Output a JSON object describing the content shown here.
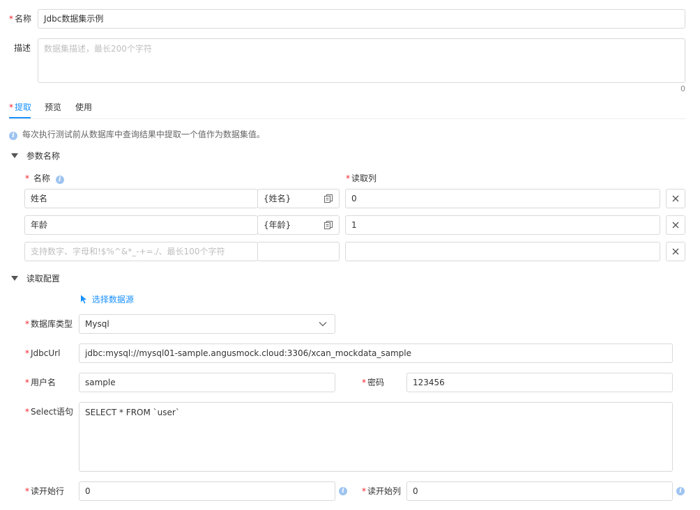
{
  "form": {
    "name_label": "名称",
    "name_value": "Jdbc数据集示例",
    "desc_label": "描述",
    "desc_placeholder": "数据集描述，最长200个字符",
    "desc_count": "0"
  },
  "tabs": [
    {
      "label": "提取",
      "active": true,
      "required": true
    },
    {
      "label": "预览",
      "active": false
    },
    {
      "label": "使用",
      "active": false
    }
  ],
  "hint": "每次执行测试前从数据库中查询结果中提取一个值作为数据集值。",
  "params_section": {
    "title": "参数名称",
    "col_name": "名称",
    "col_read": "读取列",
    "rows": [
      {
        "name": "姓名",
        "var": "{姓名}",
        "col": "0"
      },
      {
        "name": "年龄",
        "var": "{年龄}",
        "col": "1"
      }
    ],
    "new_row_placeholder": "支持数字、字母和!$%^&*_-+=./、最长100个字符"
  },
  "read_section": {
    "title": "读取配置",
    "select_source": "选择数据源",
    "db_type_label": "数据库类型",
    "db_type_value": "Mysql",
    "jdbc_label": "JdbcUrl",
    "jdbc_value": "jdbc:mysql://mysql01-sample.angusmock.cloud:3306/xcan_mockdata_sample",
    "user_label": "用户名",
    "user_value": "sample",
    "pwd_label": "密码",
    "pwd_value": "123456",
    "sql_label": "Select语句",
    "sql_value": "SELECT * FROM `user`",
    "start_row_label": "读开始行",
    "start_row_value": "0",
    "start_col_label": "读开始列",
    "start_col_value": "0"
  },
  "colors": {
    "primary": "#1890ff",
    "required": "#f5222d",
    "border": "#d9d9d9"
  }
}
